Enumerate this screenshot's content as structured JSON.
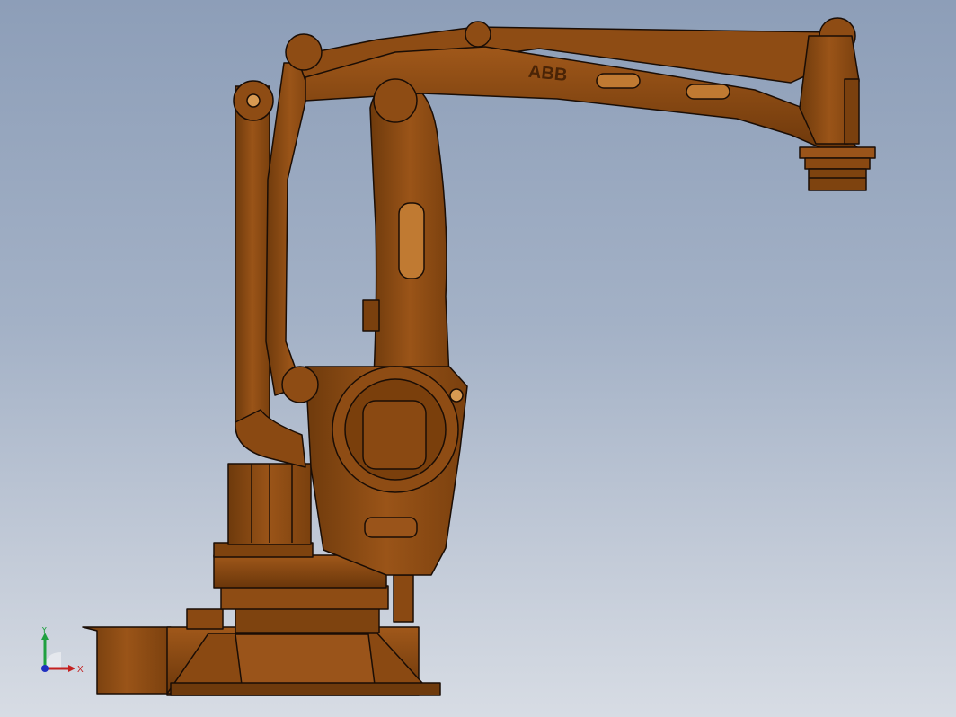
{
  "viewport": {
    "background_top": "#8d9eb8",
    "background_bottom": "#d7dce4"
  },
  "model": {
    "brand_label": "ABB",
    "body_color": "#8b4a12",
    "edge_color": "#1a0d05"
  },
  "triad": {
    "x_label": "X",
    "y_label": "Y",
    "x_color": "#c42020",
    "y_color": "#20a040",
    "z_color": "#2030c0"
  }
}
